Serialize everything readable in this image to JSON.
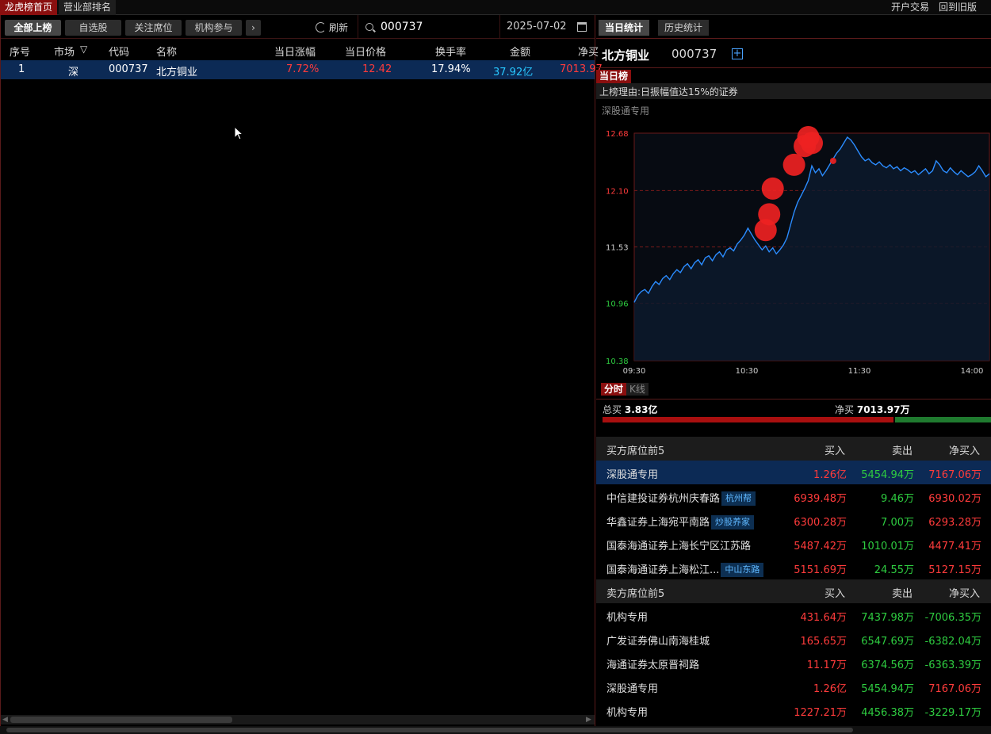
{
  "topbar": {
    "tabs": [
      "龙虎榜首页",
      "营业部排名"
    ],
    "links": [
      "开户交易",
      "回到旧版"
    ]
  },
  "filters": {
    "buttons": [
      "全部上榜",
      "自选股",
      "关注席位",
      "机构参与"
    ],
    "more_icon": "chevron-right-icon",
    "refresh_label": "刷新",
    "search_value": "000737",
    "date": "2025-07-02"
  },
  "table": {
    "headers": [
      "序号",
      "市场",
      "代码",
      "名称",
      "当日涨幅",
      "当日价格",
      "换手率",
      "金额",
      "净买"
    ],
    "rows": [
      {
        "no": "1",
        "market": "深",
        "code": "000737",
        "name": "北方铜业",
        "change": "7.72%",
        "price": "12.42",
        "turnover": "17.94%",
        "amount": "37.92亿",
        "net": "7013.97"
      }
    ]
  },
  "right": {
    "tabs": [
      "当日统计",
      "历史统计"
    ],
    "stock_name": "北方铜业",
    "stock_code": "000737",
    "badge": "当日榜",
    "reason": "上榜理由:日振幅值达15%的证券",
    "subtitle": "深股通专用",
    "chart_tabs": [
      "分时",
      "K线"
    ],
    "total_buy_label": "总买",
    "total_buy": "3.83亿",
    "net_buy_label": "净买",
    "net_buy": "7013.97万"
  },
  "chart_data": {
    "type": "line",
    "x_ticks": [
      "09:30",
      "10:30",
      "11:30",
      "14:00"
    ],
    "y_ticks": [
      12.68,
      12.1,
      11.53,
      10.96,
      10.38
    ],
    "ylim": [
      10.38,
      12.68
    ],
    "reference_price": 11.53,
    "series": [
      {
        "values": [
          10.97,
          11.04,
          11.08,
          11.1,
          11.06,
          11.13,
          11.18,
          11.15,
          11.21,
          11.24,
          11.2,
          11.26,
          11.3,
          11.27,
          11.33,
          11.36,
          11.31,
          11.37,
          11.4,
          11.35,
          11.42,
          11.44,
          11.39,
          11.45,
          11.48,
          11.43,
          11.5,
          11.52,
          11.49,
          11.56,
          11.6,
          11.65,
          11.72,
          11.66,
          11.6,
          11.55,
          11.5,
          11.54,
          11.48,
          11.52,
          11.46,
          11.5,
          11.55,
          11.62,
          11.75,
          11.88,
          11.98,
          12.05,
          12.12,
          12.2,
          12.35,
          12.28,
          12.32,
          12.25,
          12.3,
          12.36,
          12.42,
          12.48,
          12.52,
          12.58,
          12.64,
          12.61,
          12.56,
          12.5,
          12.44,
          12.4,
          12.42,
          12.38,
          12.36,
          12.39,
          12.35,
          12.33,
          12.36,
          12.32,
          12.34,
          12.3,
          12.33,
          12.31,
          12.28,
          12.3,
          12.26,
          12.29,
          12.32,
          12.27,
          12.3,
          12.4,
          12.36,
          12.3,
          12.28,
          12.33,
          12.29,
          12.26,
          12.3,
          12.27,
          12.24,
          12.26,
          12.29,
          12.35,
          12.3,
          12.24,
          12.27
        ]
      }
    ],
    "markers": [
      {
        "x": 0.37,
        "value": 11.7,
        "size": "big"
      },
      {
        "x": 0.38,
        "value": 11.86,
        "size": "big"
      },
      {
        "x": 0.39,
        "value": 12.12,
        "size": "big"
      },
      {
        "x": 0.45,
        "value": 12.36,
        "size": "big"
      },
      {
        "x": 0.48,
        "value": 12.55,
        "size": "big"
      },
      {
        "x": 0.49,
        "value": 12.64,
        "size": "big"
      },
      {
        "x": 0.5,
        "value": 12.58,
        "size": "big"
      },
      {
        "x": 0.56,
        "value": 12.4,
        "size": "small"
      }
    ]
  },
  "buyers": {
    "title": "买方席位前5",
    "cols": [
      "买入",
      "卖出",
      "净买入"
    ],
    "rows": [
      {
        "name": "深股通专用",
        "tag": "",
        "buy": "1.26亿",
        "sell": "5454.94万",
        "net": "7167.06万"
      },
      {
        "name": "中信建投证券杭州庆春路",
        "tag": "杭州帮",
        "buy": "6939.48万",
        "sell": "9.46万",
        "net": "6930.02万"
      },
      {
        "name": "华鑫证券上海宛平南路",
        "tag": "炒股养家",
        "buy": "6300.28万",
        "sell": "7.00万",
        "net": "6293.28万"
      },
      {
        "name": "国泰海通证券上海长宁区江苏路",
        "tag": "",
        "buy": "5487.42万",
        "sell": "1010.01万",
        "net": "4477.41万"
      },
      {
        "name": "国泰海通证券上海松江...",
        "tag": "中山东路",
        "buy": "5151.69万",
        "sell": "24.55万",
        "net": "5127.15万"
      }
    ]
  },
  "sellers": {
    "title": "卖方席位前5",
    "cols": [
      "买入",
      "卖出",
      "净买入"
    ],
    "rows": [
      {
        "name": "机构专用",
        "buy": "431.64万",
        "sell": "7437.98万",
        "net": "-7006.35万"
      },
      {
        "name": "广发证券佛山南海桂城",
        "buy": "165.65万",
        "sell": "6547.69万",
        "net": "-6382.04万"
      },
      {
        "name": "海通证券太原晋祠路",
        "buy": "11.17万",
        "sell": "6374.56万",
        "net": "-6363.39万"
      },
      {
        "name": "深股通专用",
        "buy": "1.26亿",
        "sell": "5454.94万",
        "net": "7167.06万"
      },
      {
        "name": "机构专用",
        "buy": "1227.21万",
        "sell": "4456.38万",
        "net": "-3229.17万"
      }
    ]
  },
  "colors": {
    "up": "#ff3b3b",
    "down": "#2ecc40",
    "line": "#2b8cff",
    "accent": "#8a0f0f",
    "select": "#0c2a55"
  }
}
